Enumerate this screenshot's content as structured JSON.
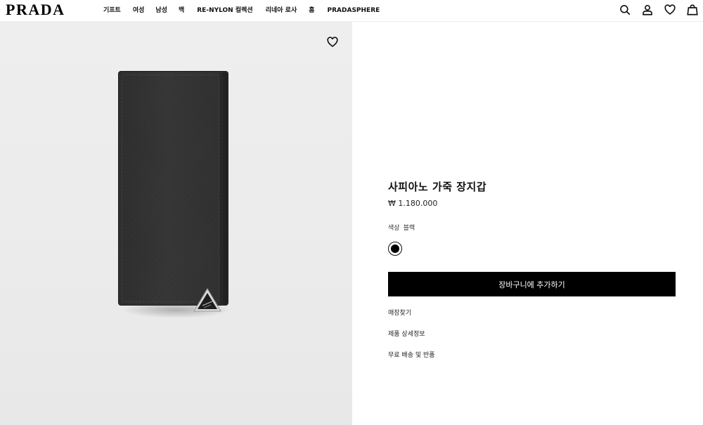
{
  "brand": {
    "logo_text": "PRADA"
  },
  "nav": {
    "items": [
      "기프트",
      "여성",
      "남성",
      "백",
      "RE-NYLON 컬렉션",
      "리네아 로사",
      "홈",
      "PRADASPHERE"
    ]
  },
  "header_icons": [
    "search-icon",
    "account-icon",
    "wishlist-icon",
    "shopping-bag-icon"
  ],
  "product": {
    "name": "사피아노 가죽 장지갑",
    "price": "₩ 1.180.000",
    "color_label": "색상",
    "color_value": "블랙",
    "selected_swatch_color": "#000000",
    "add_to_cart_label": "장바구니에 추가하기",
    "links": [
      "매장찾기",
      "제품 상세정보",
      "무료 배송 및 반품"
    ]
  },
  "colors": {
    "image_background": "#ededed",
    "button_bg": "#000000",
    "button_text": "#ffffff"
  }
}
